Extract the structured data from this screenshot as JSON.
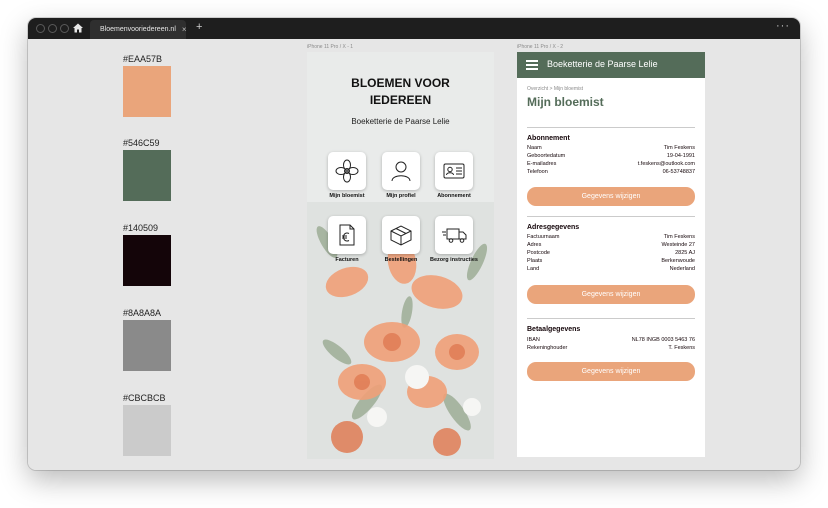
{
  "browser": {
    "tab_title": "Bloemenvooriedereen.nl",
    "tab_close": "×",
    "new_tab": "+",
    "more": "···"
  },
  "palette": [
    {
      "label": "#EAA57B",
      "color": "#EAA57B"
    },
    {
      "label": "#546C59",
      "color": "#546C59"
    },
    {
      "label": "#140509",
      "color": "#140509"
    },
    {
      "label": "#8A8A8A",
      "color": "#8A8A8A"
    },
    {
      "label": "#CBCBCB",
      "color": "#CBCBCB"
    }
  ],
  "artboards": {
    "frame1_label": "iPhone 11 Pro / X - 1",
    "frame2_label": "iPhone 11 Pro / X - 2"
  },
  "home": {
    "title_line1": "BLOEMEN VOOR",
    "title_line2": "IEDEREEN",
    "subtitle": "Boeketterie de Paarse Lelie",
    "tiles": [
      {
        "label": "Mijn bloemist",
        "icon": "flower-icon"
      },
      {
        "label": "Mijn profiel",
        "icon": "person-icon"
      },
      {
        "label": "Abonnement",
        "icon": "id-card-icon"
      },
      {
        "label": "Facturen",
        "icon": "invoice-euro-icon"
      },
      {
        "label": "Bestellingen",
        "icon": "box-icon"
      },
      {
        "label": "Bezorg instructies",
        "icon": "delivery-truck-icon"
      }
    ]
  },
  "florist": {
    "header_title": "Boeketterie de Paarse Lelie",
    "breadcrumb": "Overzicht > Mijn bloemist",
    "page_title": "Mijn bloemist",
    "sections": [
      {
        "title": "Abonnement",
        "rows": [
          {
            "key": "Naam",
            "value": "Tim Feskens"
          },
          {
            "key": "Geboortedatum",
            "value": "19-04-1991"
          },
          {
            "key": "E-mailadres",
            "value": "t.feskens@outlook.com"
          },
          {
            "key": "Telefoon",
            "value": "06-53748837"
          }
        ],
        "button": "Gegevens wijzigen"
      },
      {
        "title": "Adresgegevens",
        "rows": [
          {
            "key": "Factuurnaam",
            "value": "Tim Feskens"
          },
          {
            "key": "Adres",
            "value": "Westeinde 27"
          },
          {
            "key": "Postcode",
            "value": "2825 AJ"
          },
          {
            "key": "Plaats",
            "value": "Berkenwoude"
          },
          {
            "key": "Land",
            "value": "Nederland"
          }
        ],
        "button": "Gegevens wijzigen"
      },
      {
        "title": "Betaalgegevens",
        "rows": [
          {
            "key": "IBAN",
            "value": "NL78 INGB 0003 5463 76"
          },
          {
            "key": "Rekeninghouder",
            "value": "T. Feskens"
          }
        ],
        "button": "Gegevens wijzigen"
      }
    ]
  }
}
